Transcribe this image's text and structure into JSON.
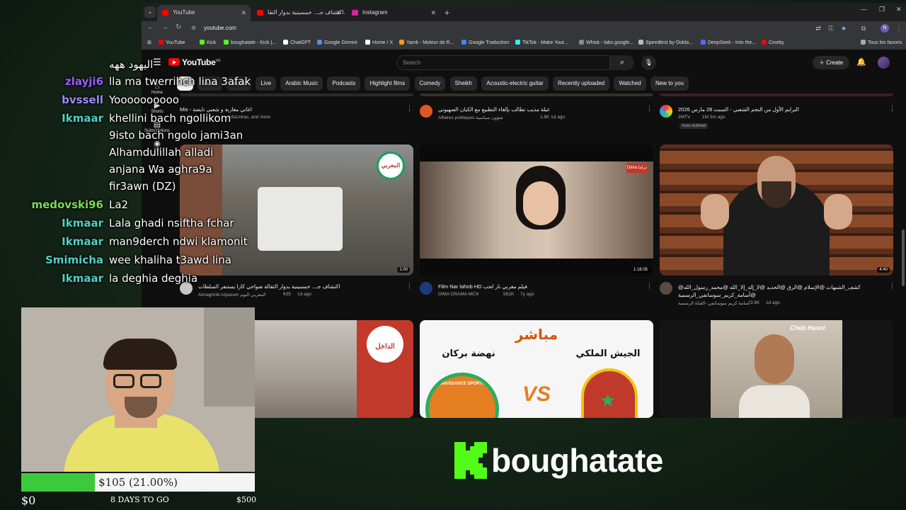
{
  "browser": {
    "tabs": [
      {
        "title": "YouTube",
        "active": true,
        "color": "#ff0000"
      },
      {
        "title": "اكتشاف جـ... خمسينية بدوار الثقا..",
        "active": false,
        "color": "#ff0000"
      },
      {
        "title": "Instagram",
        "active": false,
        "color": "#d6249f"
      }
    ],
    "url": "youtube.com",
    "bookmarks": [
      {
        "label": "YouTube",
        "color": "#ff0000"
      },
      {
        "label": "Kick",
        "color": "#53fc18"
      },
      {
        "label": "boughatate - Kick |...",
        "color": "#53fc18"
      },
      {
        "label": "ChatGPT",
        "color": "#ffffff"
      },
      {
        "label": "Google Gemini",
        "color": "#4f8ef7"
      },
      {
        "label": "Home / X",
        "color": "#ffffff"
      },
      {
        "label": "Yamli - Moteur de R...",
        "color": "#f39c12"
      },
      {
        "label": "Google Traduction",
        "color": "#4285f4"
      },
      {
        "label": "TikTok - Make Your...",
        "color": "#25f4ee"
      },
      {
        "label": "Whisk - labs.google...",
        "color": "#888888"
      },
      {
        "label": "Speedtest by Ookla...",
        "color": "#bbbbbb"
      },
      {
        "label": "DeepSeek - Into the...",
        "color": "#4d6bfe"
      },
      {
        "label": "Cineby",
        "color": "#e50914"
      }
    ],
    "all_bookmarks_label": "Tous les favoris"
  },
  "youtube": {
    "logo_text": "YouTube",
    "country_code": "MA",
    "search_placeholder": "Search",
    "create_label": "Create",
    "chips": [
      "All",
      "Music",
      "Mixes",
      "Live",
      "Arabic Music",
      "Podcasts",
      "Highlight films",
      "Comedy",
      "Sheikh",
      "Acoustic-electric guitar",
      "Recently uploaded",
      "Watched",
      "New to you"
    ],
    "guide": [
      "Home",
      "Shorts",
      "Subscriptions",
      "You"
    ],
    "row1": [
      {
        "title": "Mix - اغاني مغاربة و شعبي نايضة",
        "meta": "Mazzikas, and more"
      },
      {
        "title": "عيلة مذيب تطالب بإلغاء التطبيع مع الكيان الصهيوني",
        "channel": "Affaires politiques شؤون سياسية",
        "meta": "1.8K  1d ago"
      },
      {
        "title": "البرايم الأول من النجم الشعبي - السبت 28 مارس 2026",
        "channel": "2MTV",
        "meta": "1M  3m ago",
        "badge": "Auto-dubbed"
      }
    ],
    "row2": [
      {
        "title": "اكتشاف جـ... خمسينية بدوار الثقالة ضواحي كازا يستنفر السلطات",
        "channel": "Almaghribi Alyaoum المغربي اليوم",
        "views": "635",
        "age": "1d ago",
        "duration": "1:00",
        "thumb_label": "المغربي"
      },
      {
        "title": "Film Nar lahob HD فيلم مغربي نار لحب",
        "channel": "DIMA DRAMA MCN",
        "views": "561K",
        "age": "7y ago",
        "duration": "1:16:05",
        "thumb_label": "Dima دراما"
      },
      {
        "title": "@كشف_الشبهات @الإسلام @الرق @الحديد @لا_إله_إلا_الله @محمد_رسول_الله @أسامة_كريم_سوسانفي_الرسمية",
        "channel": "أسامة كريم سوسانفي -القناة الرسمية",
        "views": "3.8K",
        "age": "1d ago",
        "duration": "4:40"
      }
    ],
    "row3": [
      {
        "thumb_label": "الداخل"
      },
      {
        "thumb_top": "مباشر",
        "team_left": "نهضة بركان",
        "team_right": "الجيش الملكي",
        "vs": "VS",
        "thumb_label": "RENAISSANCE SPORTIVE"
      },
      {
        "thumb_label": "Cheb Hasni"
      }
    ]
  },
  "chat": [
    {
      "user": "",
      "msg": "اليهود ههه",
      "color": "#ffffff"
    },
    {
      "user": "zlayji6",
      "msg": "lla ma twerrihch lina 3afak",
      "color": "#9b59ff"
    },
    {
      "user": "bvssell",
      "msg": "Yoooooooooo",
      "color": "#9b8cff"
    },
    {
      "user": "Ikmaar",
      "msg": "khellini bach ngollikom",
      "color": "#4fd1c5"
    },
    {
      "user": "",
      "msg": "9isto bach ngolo jami3an",
      "color": "#ffffff"
    },
    {
      "user": "",
      "msg": "Alhamdulillah alladi",
      "color": "#ffffff"
    },
    {
      "user": "",
      "msg": "anjana Wa aghra9a",
      "color": "#ffffff"
    },
    {
      "user": "",
      "msg": "fir3awn (DZ)",
      "color": "#ffffff"
    },
    {
      "user": "medovski96",
      "msg": "La2",
      "color": "#7ed957"
    },
    {
      "user": "Ikmaar",
      "msg": "Lala ghadi nsiftha fchar",
      "color": "#4fd1c5"
    },
    {
      "user": "Ikmaar",
      "msg": "man9derch ndwi klamonit",
      "color": "#4fd1c5"
    },
    {
      "user": "Smimicha",
      "msg": "wee khaliha t3awd lina",
      "color": "#4fd1c5"
    },
    {
      "user": "Ikmaar",
      "msg": "la deghia deghia",
      "color": "#4fd1c5"
    }
  ],
  "goal": {
    "amount_text": "$105 (21.00%)",
    "progress_fraction": 0.21,
    "start": "$0",
    "days_left": "8 DAYS TO GO",
    "target": "$500",
    "fill_color": "#3cc93c"
  },
  "branding": {
    "channel_name": "boughatate",
    "kick_color": "#53fc18"
  }
}
